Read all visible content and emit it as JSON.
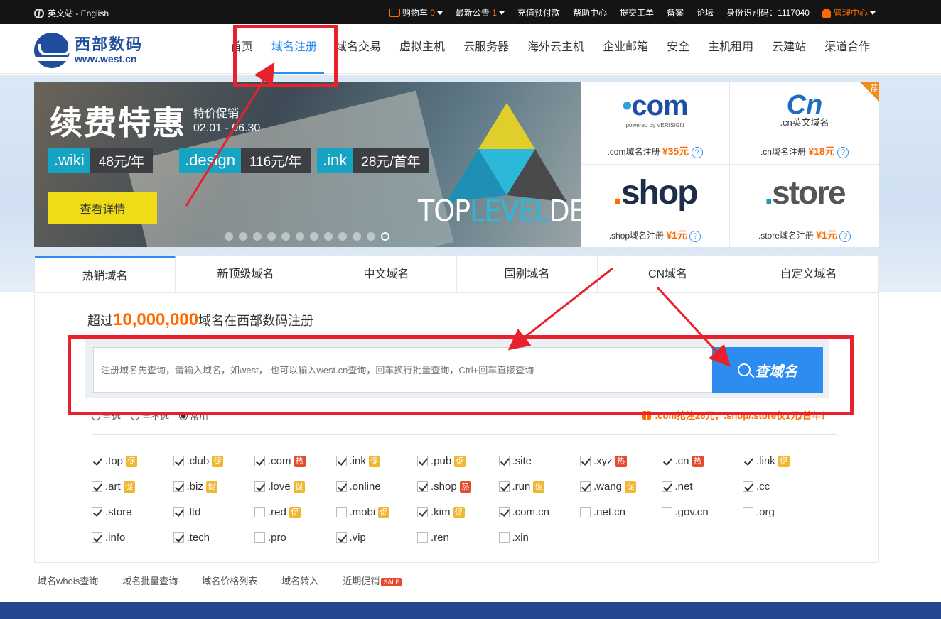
{
  "topbar": {
    "lang": "英文站 - English",
    "cart_label": "购物车",
    "cart_count": "0",
    "notice_label": "最新公告",
    "notice_count": "1",
    "links": [
      "充值预付款",
      "帮助中心",
      "提交工单",
      "备案",
      "论坛"
    ],
    "id_code": "身份识别码：1117040",
    "admin": "管理中心"
  },
  "header": {
    "logo_cn": "西部数码",
    "logo_en": "www.west.cn",
    "nav": [
      "首页",
      "域名注册",
      "域名交易",
      "虚拟主机",
      "云服务器",
      "海外云主机",
      "企业邮箱",
      "安全",
      "主机租用",
      "云建站",
      "渠道合作"
    ],
    "active_index": 1
  },
  "banner": {
    "title": "续费特惠",
    "subtitle_1": "特价促销",
    "subtitle_2": "02.01 - 06.30",
    "pills": [
      {
        "ext": ".wiki",
        "price": "48元/年"
      },
      {
        "ext": ".design",
        "price": "116元/年"
      },
      {
        "ext": ".ink",
        "price": "28元/首年"
      }
    ],
    "button": "查看详情",
    "brand_1": "TOP",
    "brand_2": "LEVEL",
    "brand_3": "DESIGN",
    "dots_total": 12,
    "dot_active": 11
  },
  "promo": {
    "recommend": "荐",
    "cells": [
      {
        "brand": "com",
        "powered": "powered by VERISIGN",
        "text": ".com域名注册",
        "price": "¥35元"
      },
      {
        "brand": "cn",
        "sub": ".cn英文域名",
        "text": ".cn域名注册",
        "price": "¥18元"
      },
      {
        "brand": "shop",
        "text": ".shop域名注册",
        "price": "¥1元"
      },
      {
        "brand": "store",
        "text": ".store域名注册",
        "price": "¥1元"
      }
    ]
  },
  "tabs": [
    "热销域名",
    "新顶级域名",
    "中文域名",
    "国别域名",
    "CN域名",
    "自定义域名"
  ],
  "search": {
    "headline_pre": "超过",
    "headline_num": "10,000,000",
    "headline_post": "域名在西部数码注册",
    "placeholder": "注册域名先查询，请输入域名，如west， 也可以输入west.cn查询，回车换行批量查询，Ctrl+回车直接查询",
    "button": "查域名",
    "radios": [
      "全选",
      "全不选",
      "常用"
    ],
    "radio_active": 2,
    "promo_text": ".com抢注26元，.shop/.store仅1元/首年！"
  },
  "domains": [
    [
      {
        "n": ".top",
        "c": true,
        "b": "促"
      },
      {
        "n": ".club",
        "c": true,
        "b": "促"
      },
      {
        "n": ".com",
        "c": true,
        "b": "热"
      },
      {
        "n": ".ink",
        "c": true,
        "b": "促"
      },
      {
        "n": ".pub",
        "c": true,
        "b": "促"
      },
      {
        "n": ".site",
        "c": true,
        "b": ""
      },
      {
        "n": ".xyz",
        "c": true,
        "b": "热"
      },
      {
        "n": ".cn",
        "c": true,
        "b": "热"
      },
      {
        "n": ".link",
        "c": true,
        "b": "促"
      }
    ],
    [
      {
        "n": ".art",
        "c": true,
        "b": "促"
      },
      {
        "n": ".biz",
        "c": true,
        "b": "促"
      },
      {
        "n": ".love",
        "c": true,
        "b": "促"
      },
      {
        "n": ".online",
        "c": true,
        "b": ""
      },
      {
        "n": ".shop",
        "c": true,
        "b": "热"
      },
      {
        "n": ".run",
        "c": true,
        "b": "促"
      },
      {
        "n": ".wang",
        "c": true,
        "b": "促"
      },
      {
        "n": ".net",
        "c": true,
        "b": ""
      },
      {
        "n": ".cc",
        "c": true,
        "b": ""
      }
    ],
    [
      {
        "n": ".store",
        "c": true,
        "b": ""
      },
      {
        "n": ".ltd",
        "c": true,
        "b": ""
      },
      {
        "n": ".red",
        "c": false,
        "b": "促"
      },
      {
        "n": ".mobi",
        "c": false,
        "b": "促"
      },
      {
        "n": ".kim",
        "c": true,
        "b": "促"
      },
      {
        "n": ".com.cn",
        "c": true,
        "b": ""
      },
      {
        "n": ".net.cn",
        "c": false,
        "b": ""
      },
      {
        "n": ".gov.cn",
        "c": false,
        "b": ""
      },
      {
        "n": ".org",
        "c": false,
        "b": ""
      }
    ],
    [
      {
        "n": ".info",
        "c": true,
        "b": ""
      },
      {
        "n": ".tech",
        "c": true,
        "b": ""
      },
      {
        "n": ".pro",
        "c": false,
        "b": ""
      },
      {
        "n": ".vip",
        "c": true,
        "b": ""
      },
      {
        "n": ".ren",
        "c": false,
        "b": ""
      },
      {
        "n": ".xin",
        "c": false,
        "b": ""
      }
    ]
  ],
  "bottom_links": [
    "域名whois查询",
    "域名批量查询",
    "域名价格列表",
    "域名转入",
    "近期促销"
  ],
  "sale_badge": "SALE",
  "colors": {
    "accent": "#2d8cf0",
    "orange": "#ff6a00",
    "annotation": "#e8222c"
  }
}
